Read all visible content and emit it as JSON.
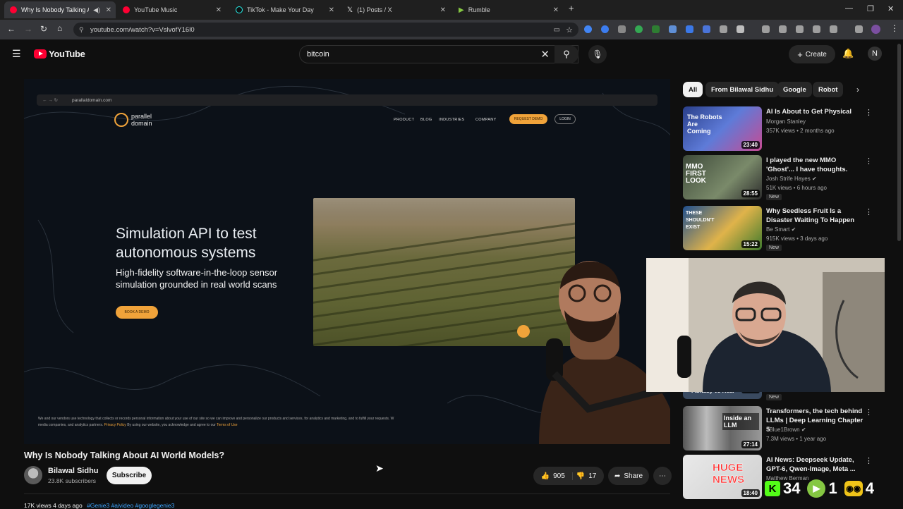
{
  "tabs": [
    {
      "label": "Why Is Nobody Talking Ab",
      "color": "#ff0033",
      "active": true
    },
    {
      "label": "YouTube Music",
      "color": "#ff0033"
    },
    {
      "label": "TikTok - Make Your Day",
      "color": "#111111"
    },
    {
      "label": "(1) Posts / X",
      "color": "#111111"
    },
    {
      "label": "Rumble",
      "color": "#85c742"
    }
  ],
  "browser": {
    "url": "youtube.com/watch?v=VslvofY16l0",
    "new_tab_icon": "plus-icon"
  },
  "header": {
    "logo_text": "YouTube",
    "search_value": "bitcoin",
    "create_label": "Create",
    "account_initial": "N"
  },
  "video": {
    "site": {
      "url": "parallaldomain.com",
      "logo_line1": "parallel",
      "logo_line2": "domain",
      "nav": [
        "PRODUCT",
        "BLOG",
        "INDUSTRIES",
        "COMPANY"
      ],
      "request_demo": "REQUEST DEMO",
      "login": "LOGIN",
      "headline": "Simulation API to test autonomous systems",
      "subhead": "High-fidelity software-in-the-loop sensor simulation grounded in real world scans",
      "book_demo": "BOOK A DEMO",
      "cookie_line1": "We and our vendors use technology that collects or records personal information about your use of our site so we can improve and personalize our products and services, for analytics and marketing, and to fulfill your requests. W",
      "cookie_line2": "media companies, and analytics partners.",
      "cookie_privacy": "Privacy Policy",
      "cookie_line3": "By using our website, you acknowledge and agree to our",
      "cookie_terms": "Terms of Use"
    },
    "title": "Why Is Nobody Talking About AI World Models?",
    "channel": "Bilawal Sidhu",
    "subscribers": "23.8K subscribers",
    "subscribe_label": "Subscribe",
    "likes": "905",
    "dislikes": "17",
    "share_label": "Share",
    "views_line": "17K views  4 days ago",
    "tags": "#Genie3 #aivideo #googlegenie3"
  },
  "chips": [
    "All",
    "From Bilawal Sidhu",
    "Google",
    "Robot"
  ],
  "recommendations": [
    {
      "title": "AI Is About to Get Physical",
      "channel": "Morgan Stanley",
      "meta": "357K views • 2 months ago",
      "duration": "23:40",
      "thumb_text": "The Robots Are Coming",
      "verified": false,
      "new": false
    },
    {
      "title": "I played the new MMO 'Ghost'... I have thoughts.",
      "channel": "Josh Strife Hayes",
      "meta": "51K views • 6 hours ago",
      "duration": "28:55",
      "thumb_text": "MMO FIRST LOOK",
      "verified": true,
      "new": true
    },
    {
      "title": "Why Seedless Fruit Is a Disaster Waiting To Happen",
      "channel": "Be Smart",
      "meta": "915K views • 3 days ago",
      "duration": "15:22",
      "thumb_text": "THESE SHOULDN'T EXIST",
      "verified": true,
      "new": true
    },
    {
      "title": "Transformers, the tech behind LLMs | Deep Learning Chapter 5",
      "channel": "3Blue1Brown",
      "meta": "7.3M views • 1 year ago",
      "duration": "27:14",
      "thumb_text": "Inside an LLM",
      "verified": true,
      "new": false
    },
    {
      "title": "AI News: Deepseek Update, GPT-6, Qwen-Image, Meta ...",
      "channel": "Matthew Berman",
      "meta": "",
      "duration": "18:40",
      "thumb_text": "HUGE NEWS",
      "verified": false,
      "new": false
    }
  ],
  "partial_rec": {
    "duration": "19:37",
    "thumb_text": "Fantasy vs Real",
    "new_label": "New"
  },
  "stream_overlay": {
    "kick_count": "34",
    "rumble_count": "1",
    "other_count": "4"
  },
  "colors": {
    "youtube_red": "#ff0033",
    "accent_orange": "#f0a33a",
    "link_blue": "#3ea6ff",
    "kick_green": "#53fc18",
    "rumble_green": "#85c742"
  }
}
